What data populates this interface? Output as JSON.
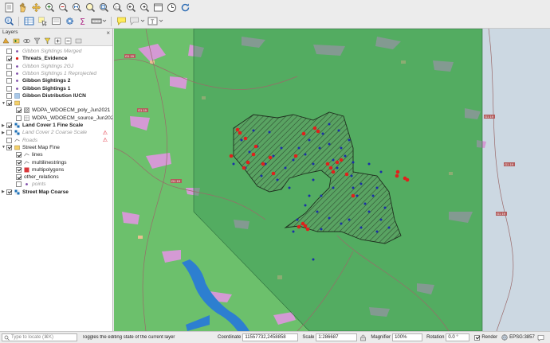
{
  "toolbar_top": {
    "icons": [
      "new-project-icon",
      "hand-pan-icon",
      "pan-to-selection-icon",
      "zoom-in-icon",
      "zoom-out-icon",
      "zoom-full-icon",
      "zoom-to-selection-icon",
      "zoom-to-layer-icon",
      "zoom-native-icon",
      "zoom-last-icon",
      "zoom-next-icon",
      "new-map-view-icon",
      "temporal-controller-icon",
      "refresh-icon"
    ]
  },
  "toolbar_second": {
    "icons": [
      "identify-icon",
      "attribute-table-icon",
      "select-features-icon",
      "deselect-icon",
      "settings-gear-icon",
      "statistics-sum-icon",
      "measure-icon",
      "map-tips-icon",
      "annotation-icon",
      "text-annotation-icon"
    ]
  },
  "layers_panel": {
    "title": "Layers",
    "items": [
      {
        "label": "Gibbon Sightings Merged",
        "checked": false,
        "style": "dim",
        "sym": "point",
        "indent": 0
      },
      {
        "label": "Threats_Evidence",
        "checked": true,
        "style": "bold",
        "sym": "point-red",
        "indent": 0
      },
      {
        "label": "Gibbon Sightings 2GJ",
        "checked": false,
        "style": "dim",
        "sym": "point",
        "indent": 0
      },
      {
        "label": "Gibbon Sightings 1 Reprojected",
        "checked": false,
        "style": "dim",
        "sym": "point",
        "indent": 0
      },
      {
        "label": "Gibbon Sightings 2",
        "checked": false,
        "style": "bold",
        "sym": "point",
        "indent": 0
      },
      {
        "label": "Gibbon Sightings 1",
        "checked": false,
        "style": "bold",
        "sym": "point",
        "indent": 0
      },
      {
        "label": "Gibbon Distribution IUCN",
        "checked": false,
        "style": "bold",
        "sym": "poly-blue",
        "indent": 0
      },
      {
        "label": "",
        "checked": true,
        "style": "normal",
        "sym": "group",
        "indent": 0,
        "expanded": true
      },
      {
        "label": "WDPA_WDOECM_poly_Jun2021",
        "checked": true,
        "style": "normal",
        "sym": "poly-hatch",
        "indent": 1
      },
      {
        "label": "WDPA_WDOECM_source_Jun2021",
        "checked": false,
        "style": "normal",
        "sym": "table",
        "indent": 1
      },
      {
        "label": "Land Cover 1 Fine Scale",
        "checked": true,
        "style": "bold",
        "sym": "raster",
        "indent": 0,
        "expanded": false
      },
      {
        "label": "Land Cover 2 Coarse Scale",
        "checked": false,
        "style": "dim",
        "sym": "raster",
        "indent": 0,
        "expanded": false,
        "warn": true
      },
      {
        "label": "Roads",
        "checked": false,
        "style": "dim",
        "sym": "line",
        "indent": 0,
        "warn": true
      },
      {
        "label": "Street Map Fine",
        "checked": true,
        "style": "normal",
        "sym": "group",
        "indent": 0,
        "expanded": true
      },
      {
        "label": "lines",
        "checked": true,
        "style": "normal",
        "sym": "line",
        "indent": 1
      },
      {
        "label": "multilinestrings",
        "checked": true,
        "style": "normal",
        "sym": "line",
        "indent": 1
      },
      {
        "label": "multipolygons",
        "checked": true,
        "style": "normal",
        "sym": "poly-red",
        "indent": 1
      },
      {
        "label": "other_relations",
        "checked": true,
        "style": "normal",
        "sym": "none",
        "indent": 1
      },
      {
        "label": "points",
        "checked": false,
        "style": "dim",
        "sym": "point",
        "indent": 1
      },
      {
        "label": "Street Map Coarse",
        "checked": true,
        "style": "bold",
        "sym": "raster",
        "indent": 0,
        "expanded": false
      }
    ]
  },
  "status_bar": {
    "locate_placeholder": "Type to locate (⌘K)",
    "message": "Toggles the editing state of the current layer",
    "coordinate_label": "Coordinate",
    "coordinate_value": "11557732,2458858",
    "scale_label": "Scale",
    "scale_value": "1:286687",
    "magnifier_label": "Magnifier",
    "magnifier_value": "100%",
    "rotation_label": "Rotation",
    "rotation_value": "0.0 °",
    "render_label": "Render",
    "render_checked": true,
    "crs_label": "EPSG:3857"
  },
  "map": {
    "road_labels": [
      "G1 19",
      "G1 19",
      "G1 19",
      "G1 19",
      "G1 19",
      "G1 19"
    ],
    "colors": {
      "background_grey": "#c7d3dc",
      "landcover_green": "#6cc06c",
      "overlay_green": "#3f9a5a",
      "water": "#2d7fd0",
      "pink": "#d49ad4",
      "sightings_blue": "#1a2fa8",
      "threats_red": "#e0201c"
    }
  }
}
